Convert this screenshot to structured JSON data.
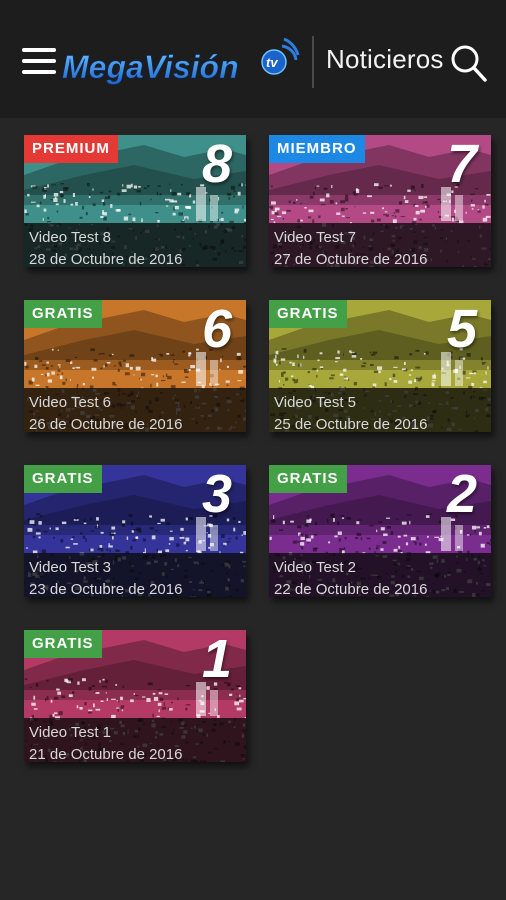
{
  "header": {
    "logo_text": "MegaVisión",
    "logo_suffix": "tv",
    "section_title": "Noticieros"
  },
  "colors": {
    "premium": "#e53935",
    "miembro": "#1e88e5",
    "gratis": "#43a047"
  },
  "videos": [
    {
      "badge": "PREMIUM",
      "number": "8",
      "title": "Video Test 8",
      "date": "28 de Octubre de 2016",
      "tint": "#3f8f8a"
    },
    {
      "badge": "MIEMBRO",
      "number": "7",
      "title": "Video Test 7",
      "date": "27 de Octubre de 2016",
      "tint": "#b34a86"
    },
    {
      "badge": "GRATIS",
      "number": "6",
      "title": "Video Test 6",
      "date": "26 de Octubre de 2016",
      "tint": "#c8762a"
    },
    {
      "badge": "GRATIS",
      "number": "5",
      "title": "Video Test 5",
      "date": "25 de Octubre de 2016",
      "tint": "#a8a83a"
    },
    {
      "badge": "GRATIS",
      "number": "3",
      "title": "Video Test 3",
      "date": "23 de Octubre de 2016",
      "tint": "#34349a"
    },
    {
      "badge": "GRATIS",
      "number": "2",
      "title": "Video Test 2",
      "date": "22 de Octubre de 2016",
      "tint": "#7b2d8f"
    },
    {
      "badge": "GRATIS",
      "number": "1",
      "title": "Video Test 1",
      "date": "21 de Octubre de 2016",
      "tint": "#b33a64"
    }
  ]
}
